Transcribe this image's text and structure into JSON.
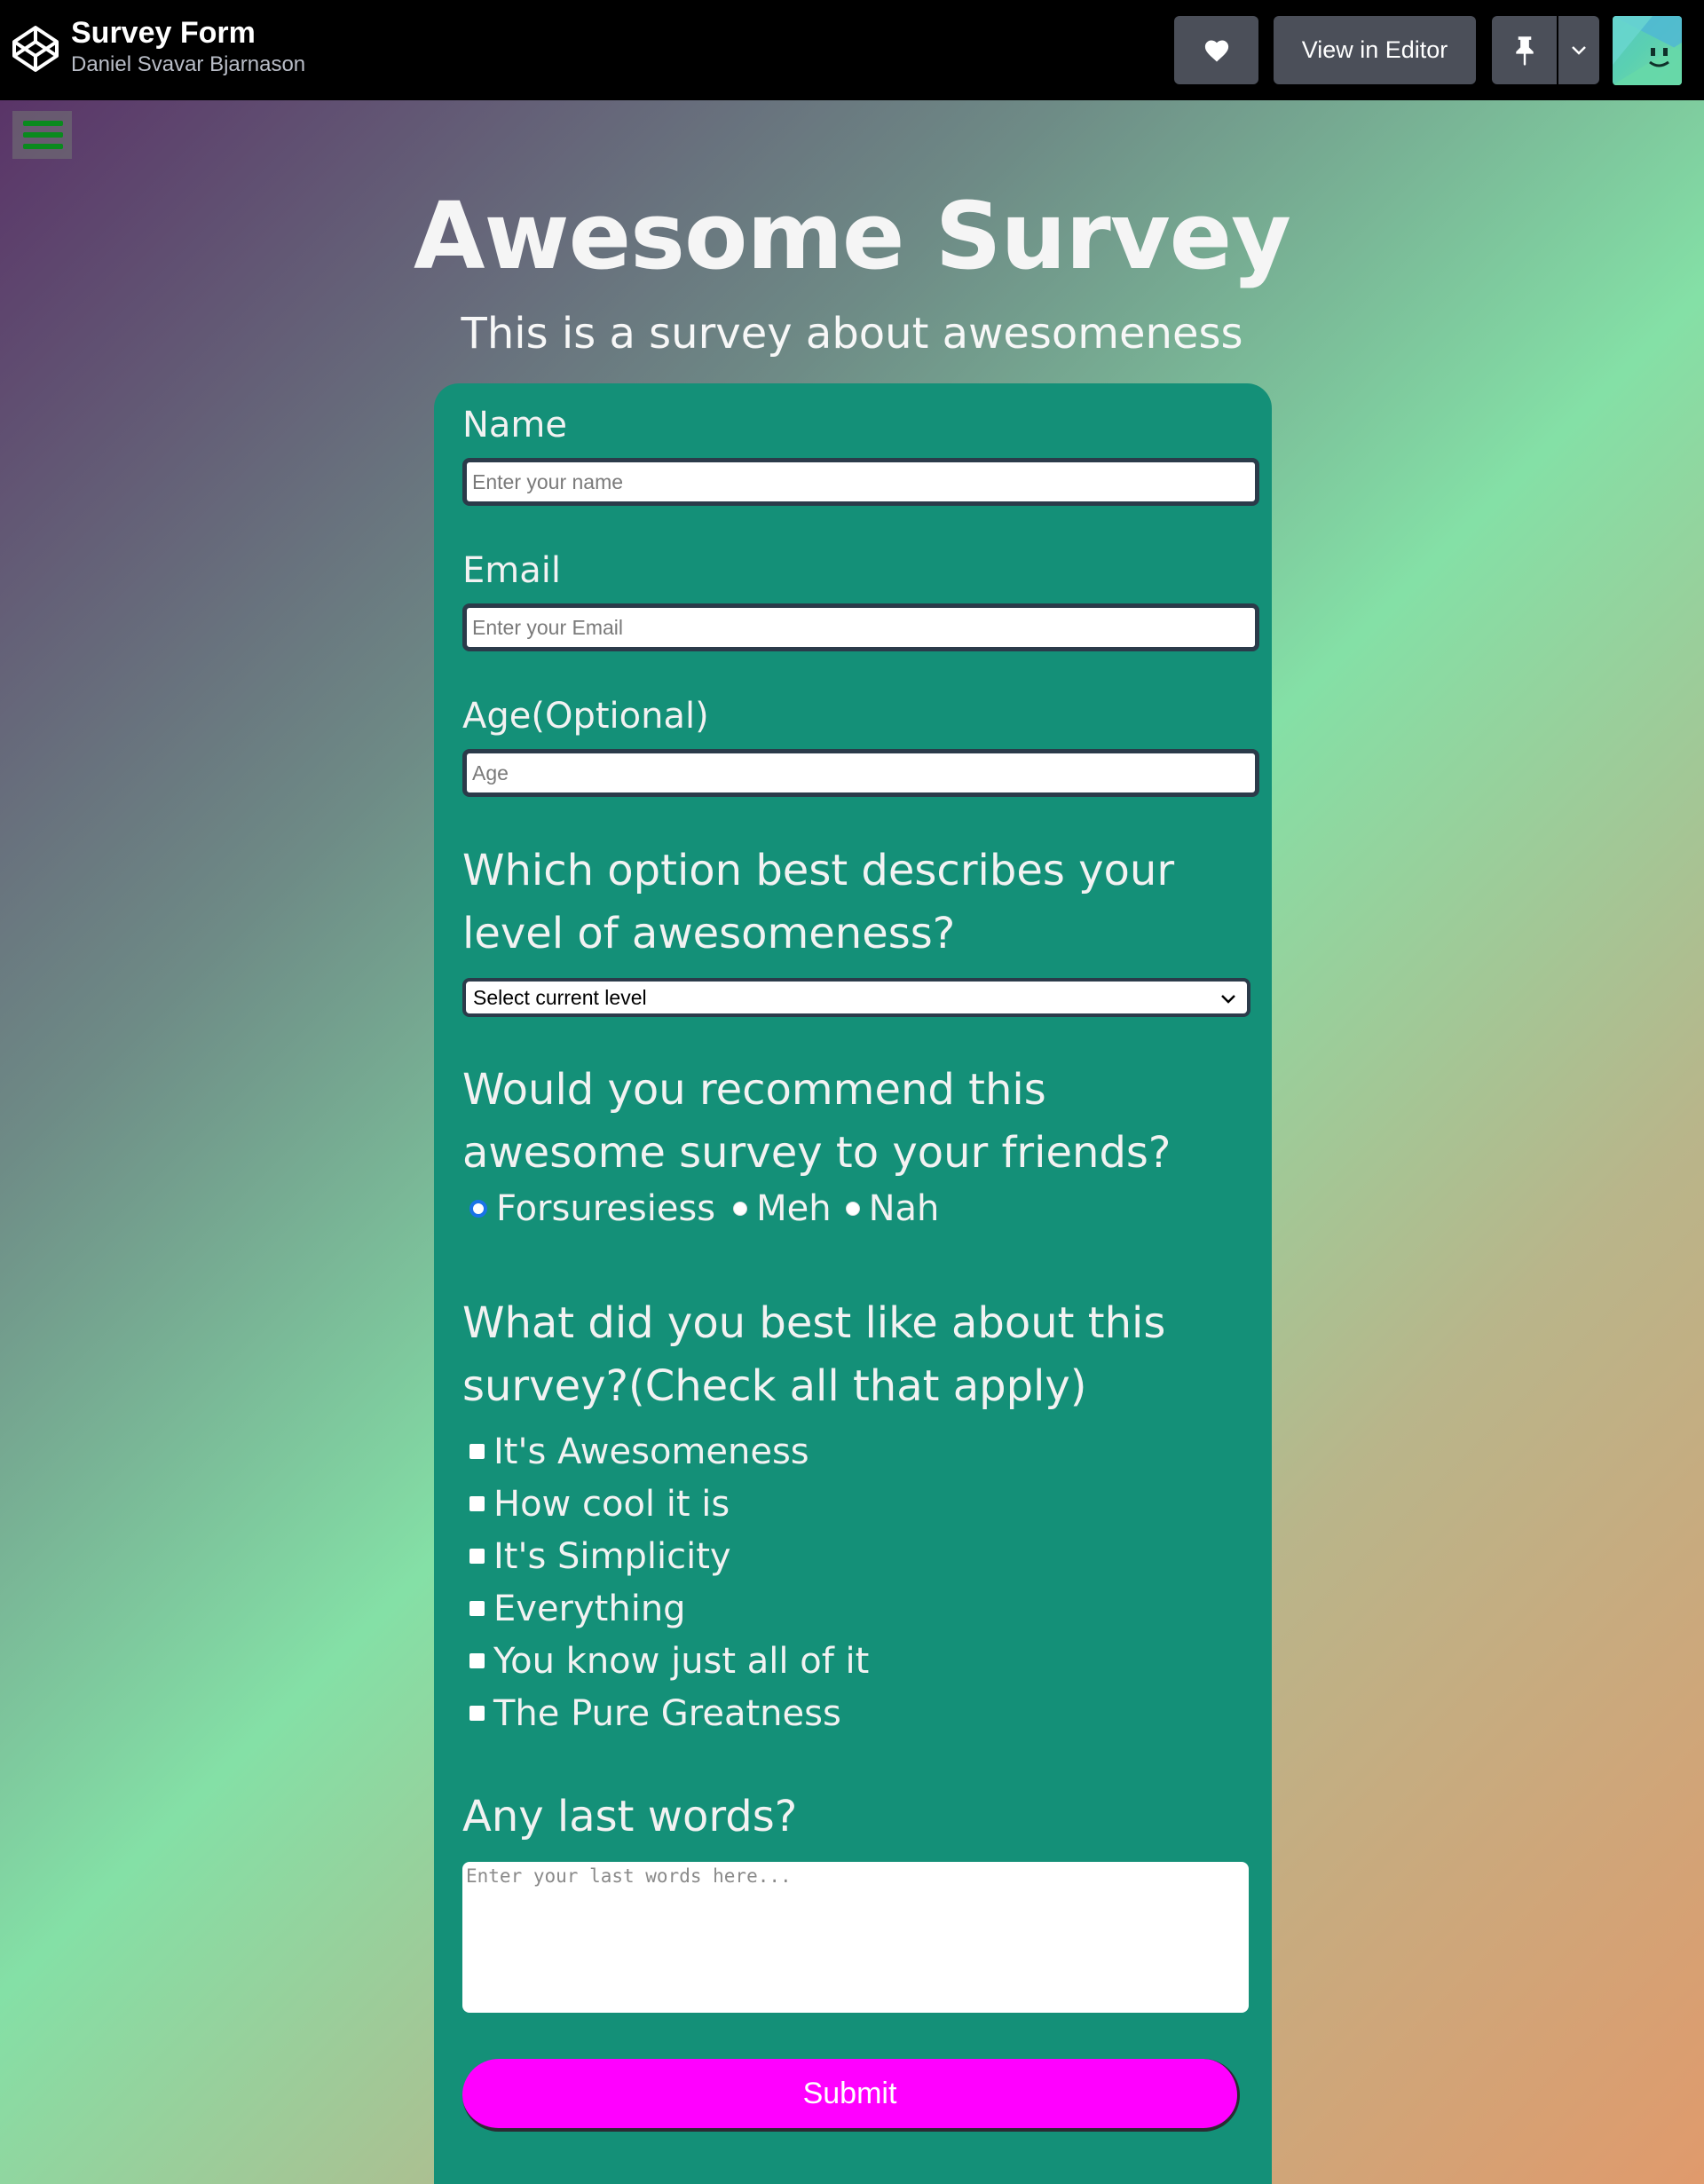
{
  "header": {
    "title": "Survey Form",
    "author": "Daniel Svavar Bjarnason",
    "view_in_editor": "View in Editor"
  },
  "page": {
    "title": "Awesome Survey",
    "subtitle": "This is a survey about awesomeness"
  },
  "form": {
    "name": {
      "label": "Name",
      "placeholder": "Enter your name"
    },
    "email": {
      "label": "Email",
      "placeholder": "Enter your Email"
    },
    "age": {
      "label": "Age(Optional)",
      "placeholder": "Age"
    },
    "level": {
      "question": "Which option best describes your level of awesomeness?",
      "selected": "Select current level"
    },
    "recommend": {
      "question": "Would you recommend this awesome survey to your friends?",
      "options": [
        "Forsuresiess",
        "Meh",
        "Nah"
      ],
      "selected": "Forsuresiess"
    },
    "liked": {
      "question": "What did you best like about this survey?(Check all that apply)",
      "options": [
        "It's Awesomeness",
        "How cool it is",
        "It's Simplicity",
        "Everything",
        "You know just all of it",
        "The Pure Greatness"
      ]
    },
    "last_words": {
      "label": "Any last words?",
      "placeholder": "Enter your last words here..."
    },
    "submit": "Submit"
  },
  "colors": {
    "card": "#149078",
    "submit": "#ff00ff",
    "topbar": "#000000"
  },
  "icons": {
    "logo": "codepen-logo-icon",
    "heart": "heart-icon",
    "pin": "pin-icon",
    "caret": "chevron-down-icon",
    "menu": "hamburger-menu-icon"
  }
}
